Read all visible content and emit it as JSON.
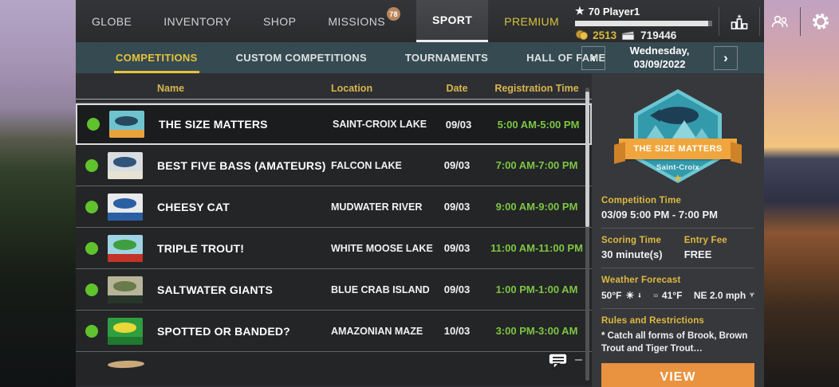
{
  "top_nav": {
    "items": [
      {
        "label": "GLOBE"
      },
      {
        "label": "INVENTORY"
      },
      {
        "label": "SHOP"
      },
      {
        "label": "MISSIONS",
        "badge": "78"
      },
      {
        "label": "SPORT"
      },
      {
        "label": "PREMIUM"
      }
    ]
  },
  "player": {
    "display": "70 Player1",
    "coins": "2513",
    "cash": "719446"
  },
  "sub_nav": {
    "tabs": [
      {
        "label": "COMPETITIONS"
      },
      {
        "label": "CUSTOM COMPETITIONS"
      },
      {
        "label": "TOURNAMENTS"
      },
      {
        "label": "HALL OF FAME"
      }
    ]
  },
  "date_selector": {
    "line1": "Wednesday,",
    "line2": "03/09/2022"
  },
  "table": {
    "headers": [
      "Name",
      "Location",
      "Date",
      "Registration Time"
    ],
    "rows": [
      {
        "selected": true,
        "name": "THE SIZE MATTERS",
        "location": "SAINT-CROIX LAKE",
        "date": "09/03",
        "time": "5:00 AM-5:00 PM",
        "logo": {
          "bg": "#6fc3cf",
          "fish": "#27495e",
          "band": "#e8a33d"
        }
      },
      {
        "selected": false,
        "name": "BEST FIVE BASS (AMATEURS)",
        "location": "FALCON LAKE",
        "date": "09/03",
        "time": "7:00 AM-7:00 PM",
        "logo": {
          "bg": "#d9dde1",
          "fish": "#31547a",
          "band": "#e6e2d4"
        }
      },
      {
        "selected": false,
        "name": "CHEESY CAT",
        "location": "MUDWATER RIVER",
        "date": "09/03",
        "time": "9:00 AM-9:00 PM",
        "logo": {
          "bg": "#e8eaec",
          "fish": "#2b5fa3",
          "band": "#2b5fa3"
        }
      },
      {
        "selected": false,
        "name": "TRIPLE TROUT!",
        "location": "WHITE MOOSE LAKE",
        "date": "09/03",
        "time": "11:00 AM-11:00 PM",
        "logo": {
          "bg": "#9fd4e4",
          "fish": "#3f9e3f",
          "band": "#c33327"
        }
      },
      {
        "selected": false,
        "name": "SALTWATER GIANTS",
        "location": "BLUE CRAB ISLAND",
        "date": "09/03",
        "time": "1:00 PM-1:00 AM",
        "logo": {
          "bg": "#b8b49a",
          "fish": "#6a7a4a",
          "band": "#27352b"
        }
      },
      {
        "selected": false,
        "name": "SPOTTED OR BANDED?",
        "location": "AMAZONIAN MAZE",
        "date": "10/03",
        "time": "3:00 PM-3:00 AM",
        "logo": {
          "bg": "#2f9e3f",
          "fish": "#e8d83a",
          "band": "#1f7a2f"
        }
      }
    ]
  },
  "details": {
    "badge_title": "THE SIZE MATTERS",
    "badge_subtitle": "Saint-Croix",
    "competition_time_label": "Competition Time",
    "competition_time": "03/09 5:00 PM - 7:00 PM",
    "scoring_time_label": "Scoring Time",
    "scoring_time": "30 minute(s)",
    "entry_fee_label": "Entry Fee",
    "entry_fee": "FREE",
    "weather_label": "Weather Forecast",
    "weather_air_temp": "50°F",
    "weather_water_temp": "41°F",
    "weather_wind": "NE 2.0 mph",
    "rules_label": "Rules and Restrictions",
    "rules_text": "* Catch all forms of Brook, Brown Trout and Tiger Trout…",
    "view_button": "VIEW"
  },
  "colors": {
    "accent_gold": "#e7c33b",
    "label_gold": "#e0b93f",
    "time_green": "#7dc642",
    "status_green": "#5fc32d",
    "view_orange": "#e9923f",
    "badge_teal": "#339aac",
    "ribbon_orange": "#f0a63c",
    "subbar_teal": "#364a51"
  }
}
